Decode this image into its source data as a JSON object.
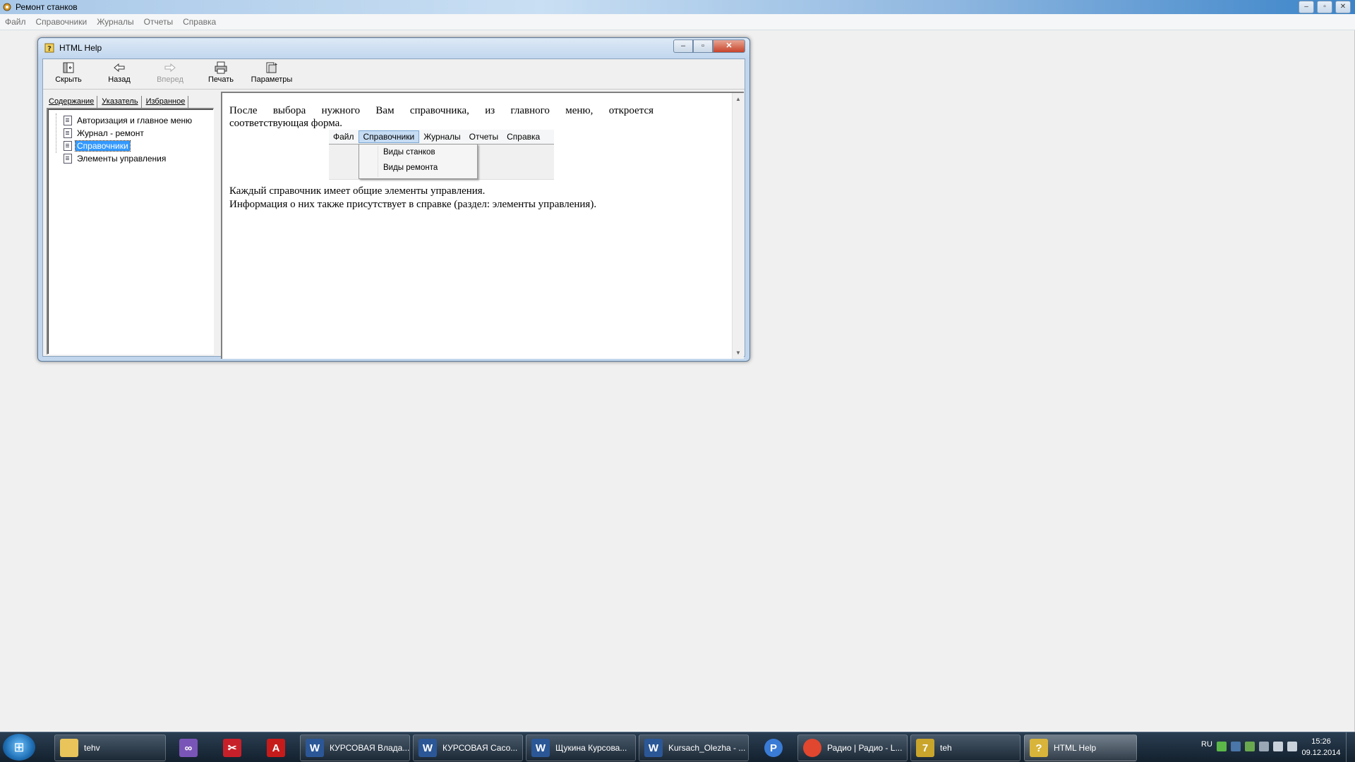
{
  "app": {
    "title": "Ремонт станков",
    "menu": [
      "Файл",
      "Справочники",
      "Журналы",
      "Отчеты",
      "Справка"
    ]
  },
  "help_window": {
    "title": "HTML Help",
    "toolbar": {
      "hide": "Скрыть",
      "back": "Назад",
      "forward": "Вперед",
      "print": "Печать",
      "options": "Параметры"
    },
    "tabs": {
      "contents": "Содержание",
      "index": "Указатель",
      "favorites": "Избранное"
    },
    "tree": [
      {
        "label": "Авторизация и главное меню",
        "selected": false
      },
      {
        "label": "Журнал - ремонт",
        "selected": false
      },
      {
        "label": "Справочники",
        "selected": true
      },
      {
        "label": "Элементы управления",
        "selected": false
      }
    ],
    "content": {
      "para1_line1": "После выбора нужного Вам справочника, из главного меню, откроется",
      "para1_line2": "соответствующая форма.",
      "demo_menu": [
        "Файл",
        "Справочники",
        "Журналы",
        "Отчеты",
        "Справка"
      ],
      "demo_dropdown": [
        "Виды станков",
        "Виды ремонта"
      ],
      "para2_line1": "Каждый справочник имеет общие элементы управления.",
      "para2_line2": "Информация о них также присутствует в справке (раздел: элементы управления)."
    }
  },
  "taskbar": {
    "items": [
      {
        "label": "tehv",
        "icon": "folder-icon",
        "color": "#e8c45a"
      },
      {
        "label": "",
        "icon": "visual-studio-icon",
        "color": "#7a55b8"
      },
      {
        "label": "",
        "icon": "snipping-tool-icon",
        "color": "#c8202a"
      },
      {
        "label": "",
        "icon": "acrobat-icon",
        "color": "#c61b1b"
      },
      {
        "label": "КУРСОВАЯ Влада...",
        "icon": "word-icon",
        "color": "#2b5797"
      },
      {
        "label": "КУРСОВАЯ Сасо...",
        "icon": "word-icon",
        "color": "#2b5797"
      },
      {
        "label": "Щукина Курсова...",
        "icon": "word-icon",
        "color": "#2b5797"
      },
      {
        "label": "Kursach_Olezha - ...",
        "icon": "word-icon",
        "color": "#2b5797"
      },
      {
        "label": "",
        "icon": "pscp-icon",
        "color": "#3a7bd5"
      },
      {
        "label": "Радио | Радио - L...",
        "icon": "chrome-icon",
        "color": "#e1462f"
      },
      {
        "label": "teh",
        "icon": "delphi-icon",
        "color": "#c9a52c"
      },
      {
        "label": "HTML Help",
        "icon": "help-icon",
        "color": "#d8b43a"
      }
    ],
    "language": "RU",
    "time": "15:26",
    "date": "09.12.2014"
  },
  "colors": {
    "selection": "#3399ff",
    "taskbar_bg": "#1c2b3a"
  }
}
